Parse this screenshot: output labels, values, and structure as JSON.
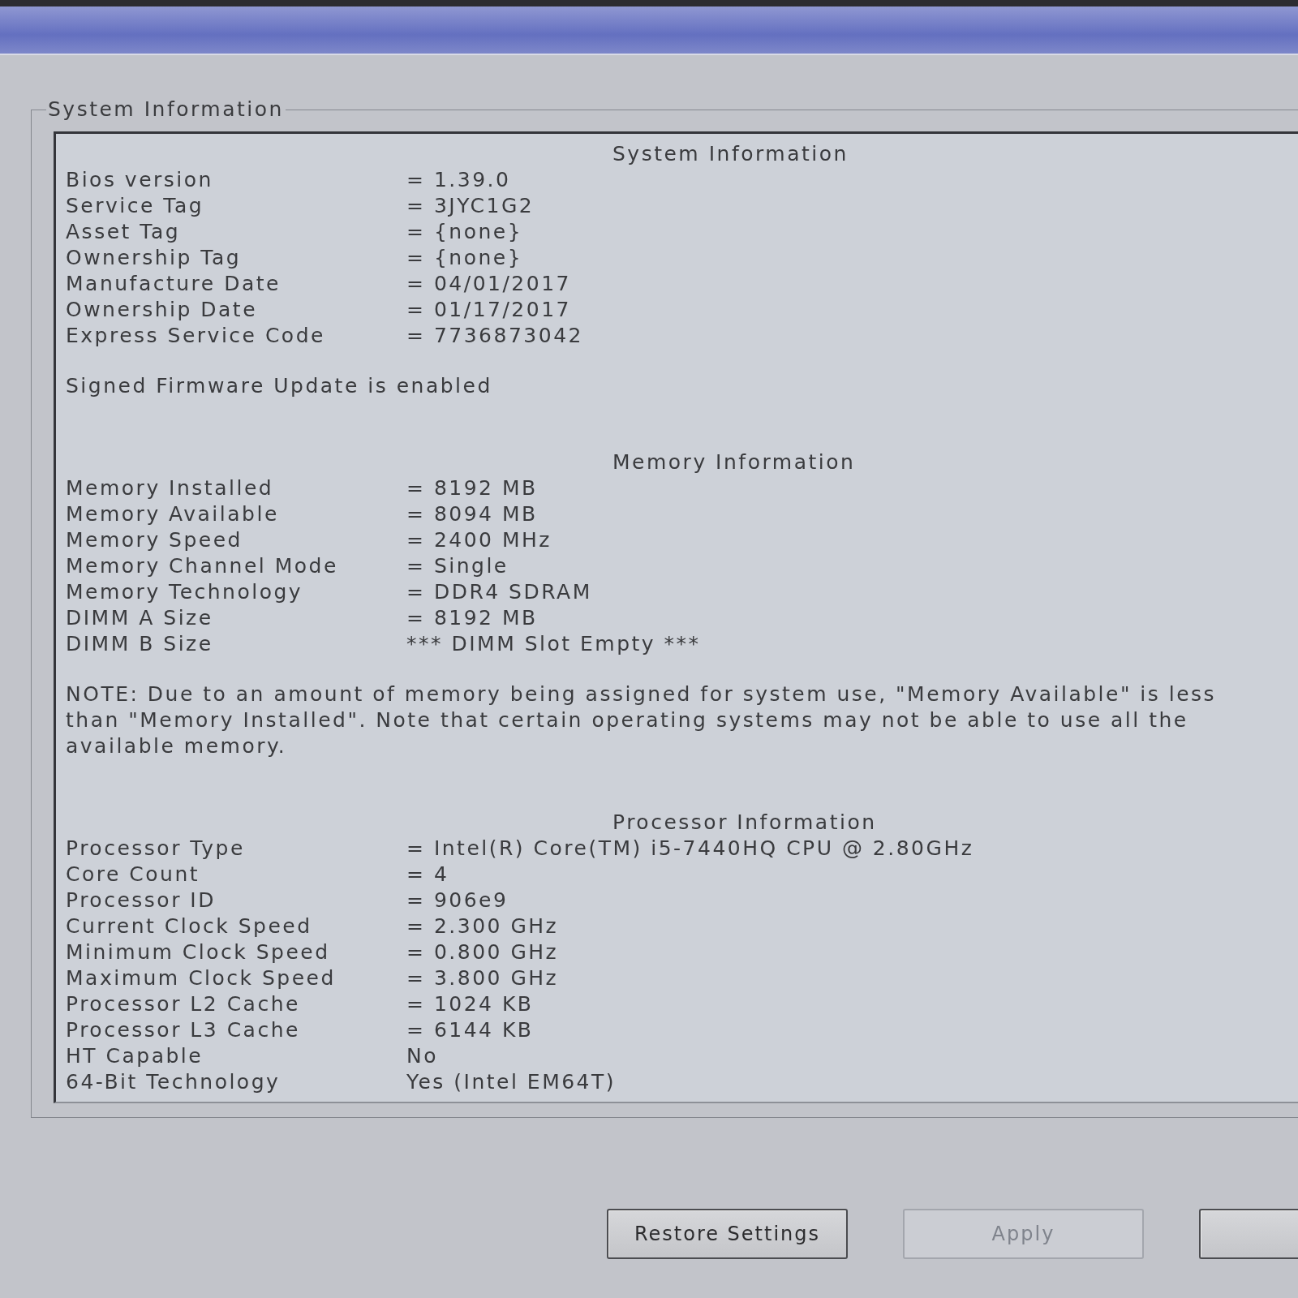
{
  "group_box": {
    "legend": "System Information"
  },
  "sections": [
    {
      "heading": "System Information",
      "rows": [
        {
          "label": "Bios version",
          "value": "= 1.39.0"
        },
        {
          "label": "Service Tag",
          "value": "= 3JYC1G2"
        },
        {
          "label": "Asset Tag",
          "value": "= {none}"
        },
        {
          "label": "Ownership Tag",
          "value": "= {none}"
        },
        {
          "label": "Manufacture Date",
          "value": "= 04/01/2017"
        },
        {
          "label": "Ownership Date",
          "value": "= 01/17/2017"
        },
        {
          "label": "Express Service Code",
          "value": "= 7736873042"
        }
      ],
      "note": "Signed Firmware Update is enabled"
    },
    {
      "heading": "Memory Information",
      "rows": [
        {
          "label": "Memory Installed",
          "value": "= 8192 MB"
        },
        {
          "label": "Memory Available",
          "value": "= 8094 MB"
        },
        {
          "label": "Memory Speed",
          "value": "= 2400 MHz"
        },
        {
          "label": "Memory Channel Mode",
          "value": "= Single"
        },
        {
          "label": "Memory Technology",
          "value": "= DDR4 SDRAM"
        },
        {
          "label": "DIMM A Size",
          "value": "= 8192 MB"
        },
        {
          "label": "DIMM B Size",
          "value": "*** DIMM Slot Empty ***"
        }
      ],
      "note": "NOTE: Due to an amount of memory being assigned for system use, \"Memory Available\" is less than \"Memory Installed\". Note that certain operating systems may not be able to use all the available memory."
    },
    {
      "heading": "Processor Information",
      "rows": [
        {
          "label": "Processor Type",
          "value": "= Intel(R) Core(TM) i5-7440HQ CPU @ 2.80GHz"
        },
        {
          "label": "Core Count",
          "value": "= 4"
        },
        {
          "label": "Processor ID",
          "value": "= 906e9"
        },
        {
          "label": "Current Clock Speed",
          "value": "= 2.300 GHz"
        },
        {
          "label": "Minimum Clock Speed",
          "value": "= 0.800 GHz"
        },
        {
          "label": "Maximum Clock Speed",
          "value": "= 3.800 GHz"
        },
        {
          "label": "Processor L2 Cache",
          "value": "= 1024 KB"
        },
        {
          "label": "Processor L3 Cache",
          "value": "= 6144 KB"
        },
        {
          "label": "HT Capable",
          "value": "No"
        },
        {
          "label": "64-Bit Technology",
          "value": "Yes (Intel EM64T)"
        }
      ]
    }
  ],
  "buttons": [
    {
      "label": "Restore Settings",
      "disabled": false
    },
    {
      "label": "Apply",
      "disabled": true
    },
    {
      "disabled": false
    }
  ]
}
